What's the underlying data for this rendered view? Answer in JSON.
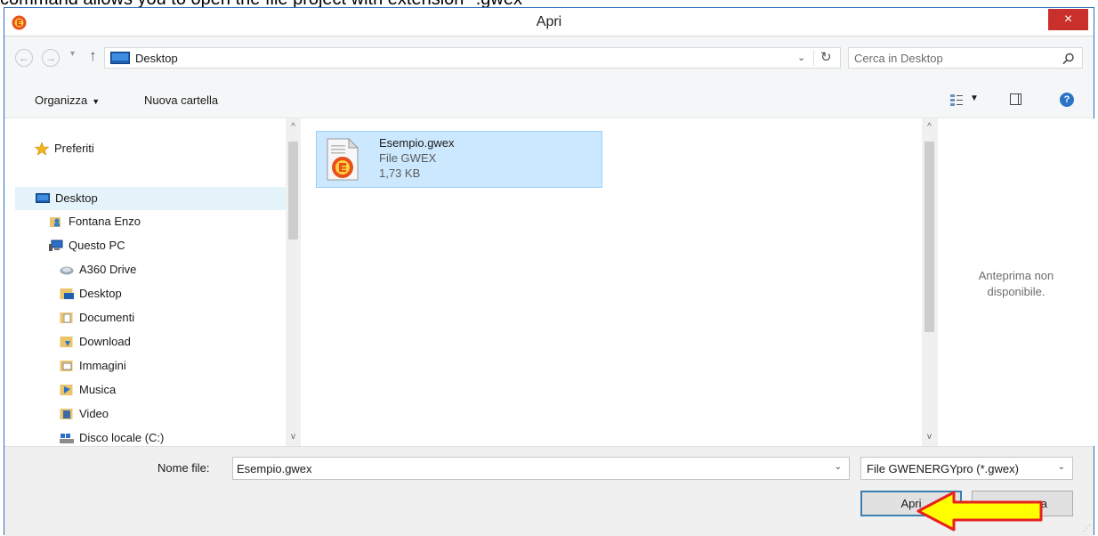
{
  "caption": "command allows you to open the file project with extension *.gwex",
  "window": {
    "title": "Apri",
    "close_glyph": "×",
    "app_icon": "gwenergy-app-icon",
    "accent": "#2b6fb4",
    "close_color": "#c9302c"
  },
  "addressbar": {
    "back_glyph": "←",
    "forward_glyph": "→",
    "recent_glyph": "▾",
    "up_glyph": "↑",
    "path": "Desktop",
    "path_dropdown_glyph": "⌄",
    "refresh_glyph": "↻",
    "search_placeholder": "Cerca in Desktop"
  },
  "toolbar": {
    "organize": "Organizza",
    "organize_dd": "▼",
    "new_folder": "Nuova cartella",
    "view_dd": "▼",
    "help": "?"
  },
  "navpane": {
    "items": [
      {
        "label": "Preferiti",
        "icon": "star-icon"
      },
      {
        "label": "Desktop",
        "icon": "desktop-icon",
        "selected": true
      },
      {
        "label": "Fontana Enzo",
        "icon": "user-folder-icon"
      },
      {
        "label": "Questo PC",
        "icon": "computer-icon"
      },
      {
        "label": "A360 Drive",
        "icon": "cloud-drive-icon"
      },
      {
        "label": "Desktop",
        "icon": "desktop-folder-icon"
      },
      {
        "label": "Documenti",
        "icon": "documents-folder-icon"
      },
      {
        "label": "Download",
        "icon": "download-folder-icon"
      },
      {
        "label": "Immagini",
        "icon": "pictures-folder-icon"
      },
      {
        "label": "Musica",
        "icon": "music-folder-icon"
      },
      {
        "label": "Video",
        "icon": "video-folder-icon"
      },
      {
        "label": "Disco locale (C:)",
        "icon": "drive-icon"
      }
    ],
    "selected_color": "#e5f3fb"
  },
  "files": [
    {
      "name": "Esempio.gwex",
      "type": "File GWEX",
      "size": "1,73 KB",
      "icon": "gwex-file-icon"
    }
  ],
  "preview": {
    "line1": "Anteprima non",
    "line2": "disponibile."
  },
  "bottom": {
    "filename_label": "Nome file:",
    "filename_value": "Esempio.gwex",
    "filter_value": "File GWENERGYpro (*.gwex)",
    "dropdown_glyph": "⌄",
    "open_label": "Apri",
    "cancel_label_visible": "a",
    "grip": "⋰"
  },
  "annotation": {
    "icon": "yellow-arrow-pointer",
    "fill": "#ffff00",
    "stroke": "#e8211c"
  }
}
